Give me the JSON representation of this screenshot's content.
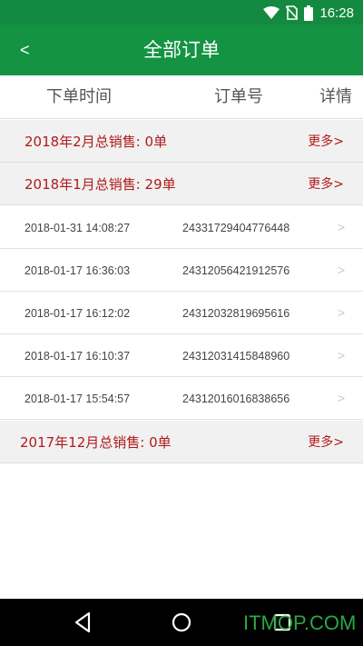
{
  "status_bar": {
    "time": "16:28",
    "icons": [
      "wifi-icon",
      "no-sim-icon",
      "battery-icon"
    ]
  },
  "header": {
    "back_label": "<",
    "title": "全部订单"
  },
  "columns": {
    "time": "下单时间",
    "order_no": "订单号",
    "detail": "详情"
  },
  "months": [
    {
      "label": "2018年2月总销售:  0单",
      "more": "更多>"
    },
    {
      "label": "2018年1月总销售:  29单",
      "more": "更多>"
    },
    {
      "label": "2017年12月总销售:  0单",
      "more": "更多>"
    }
  ],
  "orders": [
    {
      "time": "2018-01-31 14:08:27",
      "id": "24331729404776448",
      "chevron": ">"
    },
    {
      "time": "2018-01-17 16:36:03",
      "id": "24312056421912576",
      "chevron": ">"
    },
    {
      "time": "2018-01-17 16:12:02",
      "id": "24312032819695616",
      "chevron": ">"
    },
    {
      "time": "2018-01-17 16:10:37",
      "id": "24312031415848960",
      "chevron": ">"
    },
    {
      "time": "2018-01-17 15:54:57",
      "id": "24312016016838656",
      "chevron": ">"
    }
  ],
  "nav": {
    "icons": [
      "back-triangle-icon",
      "home-circle-icon",
      "recents-square-icon"
    ]
  },
  "watermark": "ITMOP.COM",
  "colors": {
    "primary": "#149343",
    "status": "#138a3f",
    "month_text": "#b01b1b",
    "section_bg": "#f1f1f1"
  }
}
